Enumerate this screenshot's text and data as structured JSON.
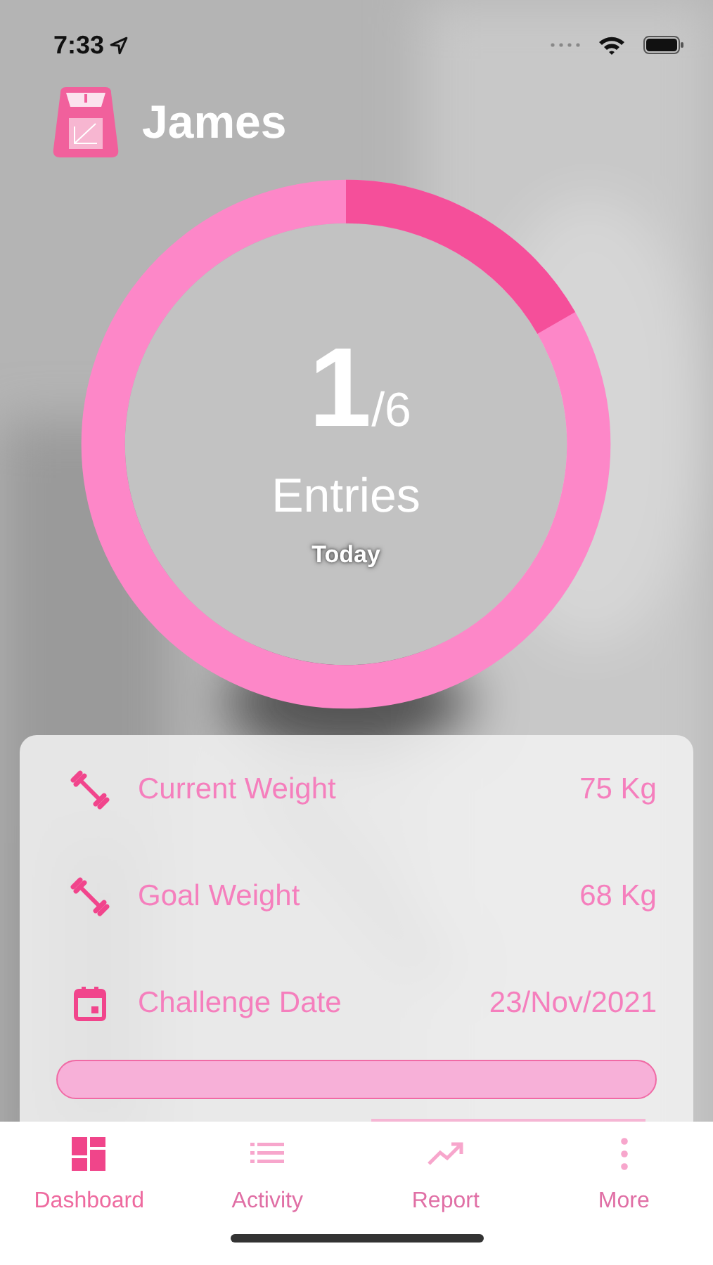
{
  "status_bar": {
    "time": "7:33"
  },
  "header": {
    "title": "James"
  },
  "entries": {
    "count": "1",
    "total": "/6",
    "label": "Entries",
    "sublabel": "Today"
  },
  "stats": [
    {
      "kind": "dumbbell",
      "label": "Current Weight",
      "value": "75 Kg"
    },
    {
      "kind": "dumbbell",
      "label": "Goal Weight",
      "value": "68 Kg"
    },
    {
      "kind": "calendar",
      "label": "Challenge Date",
      "value": "23/Nov/2021"
    }
  ],
  "tabs": [
    {
      "kind": "dashboard",
      "label": "Dashboard",
      "selected": true
    },
    {
      "kind": "list",
      "label": "Activity",
      "selected": false
    },
    {
      "kind": "chart",
      "label": "Report",
      "selected": false
    },
    {
      "kind": "more",
      "label": "More",
      "selected": false
    }
  ]
}
